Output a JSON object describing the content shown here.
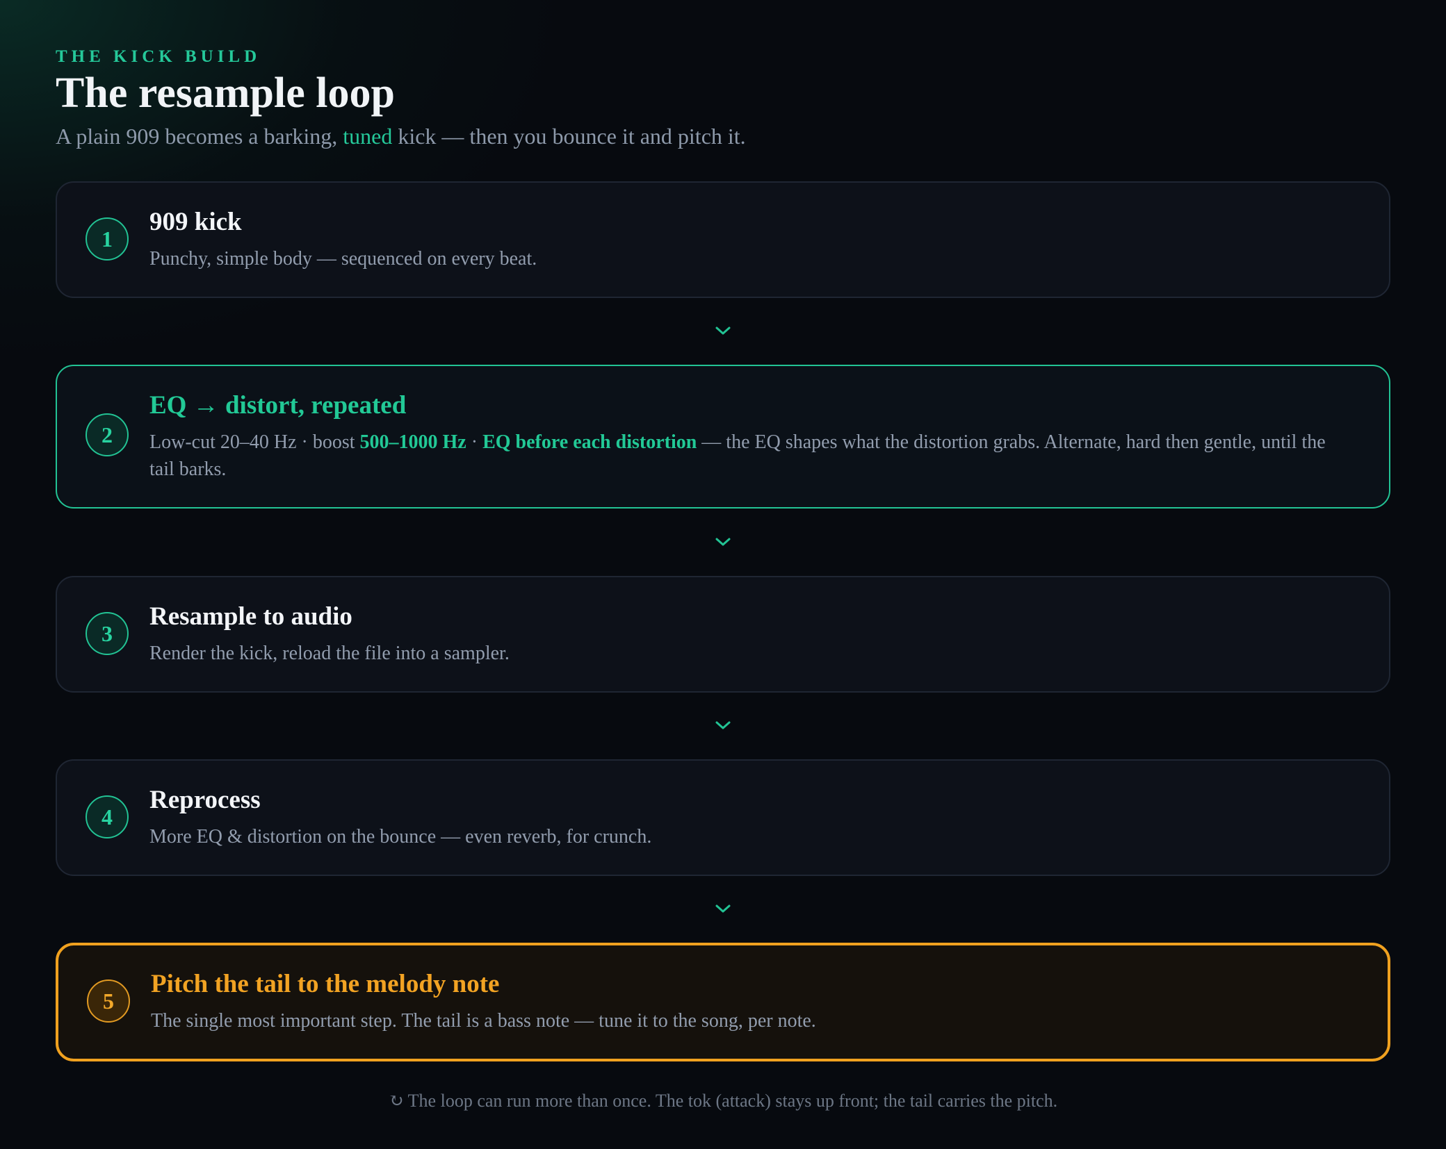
{
  "header": {
    "eyebrow": "THE KICK BUILD",
    "title": "The resample loop",
    "subtitle_pre": "A plain 909 becomes a barking, ",
    "subtitle_accent": "tuned",
    "subtitle_post": " kick — then you bounce it and pitch it."
  },
  "steps": [
    {
      "number": "1",
      "title": "909 kick",
      "desc": "Punchy, simple body — sequenced on every beat."
    },
    {
      "number": "2",
      "title": "EQ → distort, repeated",
      "desc_a": "Low-cut 20–40 Hz · boost ",
      "desc_hl1": "500–1000 Hz",
      "desc_b": " · ",
      "desc_hl2": "EQ before each distortion",
      "desc_c": " — the EQ shapes what the distortion grabs. Alternate, hard then gentle, until the tail barks."
    },
    {
      "number": "3",
      "title": "Resample to audio",
      "desc": "Render the kick, reload the file into a sampler."
    },
    {
      "number": "4",
      "title": "Reprocess",
      "desc": "More EQ & distortion on the bounce — even reverb, for crunch."
    },
    {
      "number": "5",
      "title": "Pitch the tail to the melody note",
      "desc": "The single most important step. The tail is a bass note — tune it to the song, per note."
    }
  ],
  "connector_icon": "chevron-down-icon",
  "footer": {
    "icon": "loop-arrow-icon",
    "icon_glyph": "↻",
    "text": "The loop can run more than once. The tok (attack) stays up front; the tail carries the pitch."
  },
  "colors": {
    "background": "#070a0f",
    "accent_teal": "#22c996",
    "accent_amber": "#f2a323",
    "card": "#0d1119",
    "muted_text": "#929dae"
  }
}
